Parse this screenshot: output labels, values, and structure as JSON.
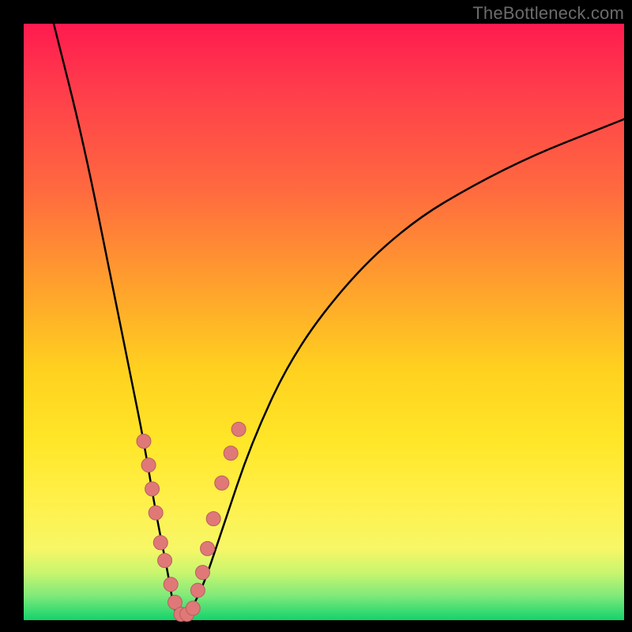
{
  "watermark": {
    "text": "TheBottleneck.com"
  },
  "palette": {
    "curve_stroke": "#000000",
    "marker_fill": "#e07878",
    "marker_stroke": "#b85f5f",
    "gradient_top": "#ff1a4f",
    "gradient_mid": "#ffd11f",
    "gradient_bottom": "#12d36c"
  },
  "chart_data": {
    "type": "line",
    "title": "",
    "xlabel": "",
    "ylabel": "",
    "xlim": [
      0,
      100
    ],
    "ylim": [
      0,
      100
    ],
    "grid": false,
    "legend": false,
    "series": [
      {
        "name": "bottleneck-curve",
        "x": [
          5,
          10,
          15,
          18,
          20,
          22,
          24,
          25,
          26,
          27,
          28,
          30,
          33,
          38,
          45,
          55,
          65,
          75,
          85,
          95,
          100
        ],
        "y": [
          100,
          80,
          55,
          40,
          30,
          18,
          8,
          2,
          0,
          0,
          2,
          6,
          15,
          30,
          45,
          58,
          67,
          73,
          78,
          82,
          84
        ]
      }
    ],
    "markers": {
      "name": "highlight-points",
      "x": [
        20.0,
        20.8,
        21.4,
        22.0,
        22.8,
        23.5,
        24.5,
        25.2,
        26.2,
        27.2,
        28.2,
        29.0,
        29.8,
        30.6,
        31.6,
        33.0,
        34.5,
        35.8
      ],
      "y": [
        30,
        26,
        22,
        18,
        13,
        10,
        6,
        3,
        1,
        1,
        2,
        5,
        8,
        12,
        17,
        23,
        28,
        32
      ]
    }
  }
}
